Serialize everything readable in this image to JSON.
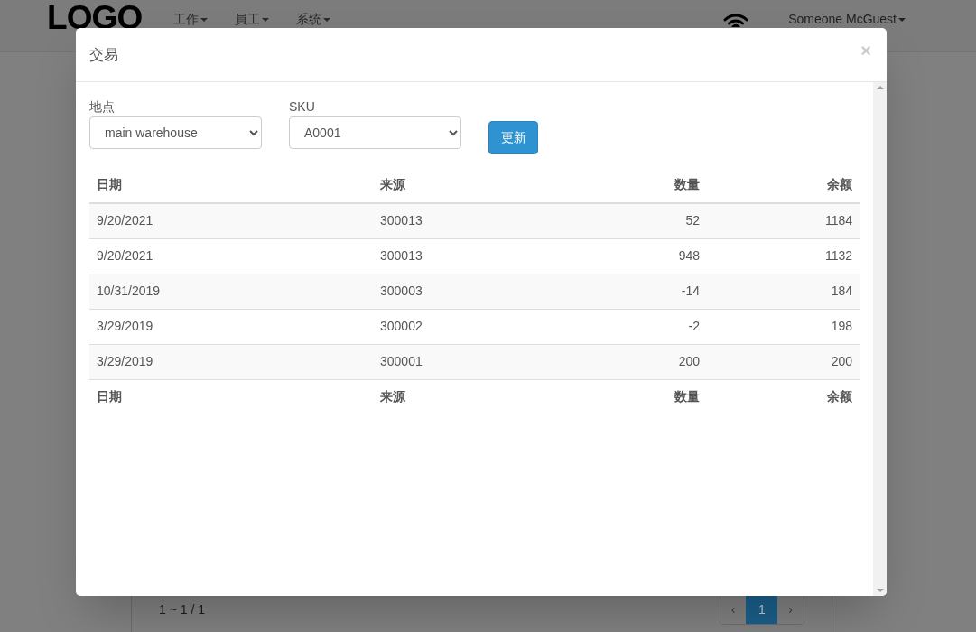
{
  "header": {
    "logo": "LOGO",
    "nav": [
      "工作",
      "員工",
      "系统"
    ],
    "user": "Someone McGuest"
  },
  "background": {
    "pager_summary": "1 ~ 1 / 1",
    "pagination": [
      {
        "label": "‹",
        "selected": false
      },
      {
        "label": "1",
        "selected": true
      },
      {
        "label": "›",
        "selected": false
      }
    ]
  },
  "modal": {
    "title": "交易",
    "close": "×",
    "filters": [
      {
        "label": "地点",
        "value": "main warehouse"
      },
      {
        "label": "SKU",
        "value": "A0001"
      }
    ],
    "update_button": "更新",
    "table": {
      "columns": [
        "日期",
        "来源",
        "数量",
        "余额"
      ],
      "rows": [
        [
          "9/20/2021",
          "300013",
          "52",
          "1184"
        ],
        [
          "9/20/2021",
          "300013",
          "948",
          "1132"
        ],
        [
          "10/31/2019",
          "300003",
          "-14",
          "184"
        ],
        [
          "3/29/2019",
          "300002",
          "-2",
          "198"
        ],
        [
          "3/29/2019",
          "300001",
          "200",
          "200"
        ]
      ],
      "footer": [
        "日期",
        "来源",
        "数量",
        "余额"
      ]
    }
  }
}
